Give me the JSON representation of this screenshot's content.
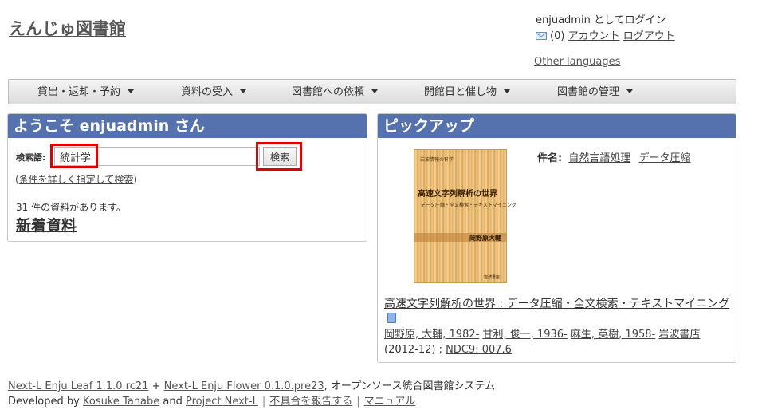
{
  "site": {
    "title": "えんじゅ図書館"
  },
  "login": {
    "status": "enjuadmin としてログイン",
    "message_count": "(0)",
    "account_link": "アカウント",
    "logout_link": "ログアウト",
    "other_languages": "Other languages"
  },
  "nav": {
    "items": [
      {
        "label": "貸出・返却・予約"
      },
      {
        "label": "資料の受入"
      },
      {
        "label": "図書館への依頼"
      },
      {
        "label": "開館日と催し物"
      },
      {
        "label": "図書館の管理"
      }
    ]
  },
  "welcome": {
    "title": "ようこそ enjuadmin さん",
    "search_label": "検索語:",
    "search_value": "統計学",
    "search_button": "検索",
    "advanced_open": "(",
    "advanced_link": "条件を詳しく指定して検索",
    "advanced_close": ")",
    "count_text": "31 件の資料があります。",
    "new_items": "新着資料"
  },
  "pickup": {
    "title": "ピックアップ",
    "cover": {
      "series": "岩波情報の科学",
      "title": "高速文字列解析の世界",
      "subtitle": "データ圧縮・全文検索・テキストマイニング",
      "author": "岡野原大輔",
      "publisher": "岩波書店"
    },
    "subject_label": "件名:",
    "subjects": [
      "自然言語処理",
      "データ圧縮"
    ],
    "book_title": "高速文字列解析の世界 : データ圧縮・全文検索・テキストマイニング",
    "creators": [
      "岡野原, 大輔, 1982-",
      "甘利, 俊一, 1936-",
      "麻生, 英樹, 1958-"
    ],
    "publisher": "岩波書店",
    "date": "(2012-12)",
    "ndc": "NDC9: 007.6"
  },
  "footer": {
    "leaf": "Next-L Enju Leaf 1.1.0.rc21",
    "plus": "+",
    "flower": "Next-L Enju Flower 0.1.0.pre23",
    "system_text": ", オープンソース統合図書館システム",
    "developed_by": "Developed by",
    "author": "Kosuke Tanabe",
    "and": "and",
    "project": "Project Next-L",
    "report": "不具合を報告する",
    "manual": "マニュアル"
  },
  "colors": {
    "panel_header": "#5571ae",
    "highlight": "#e00000"
  }
}
